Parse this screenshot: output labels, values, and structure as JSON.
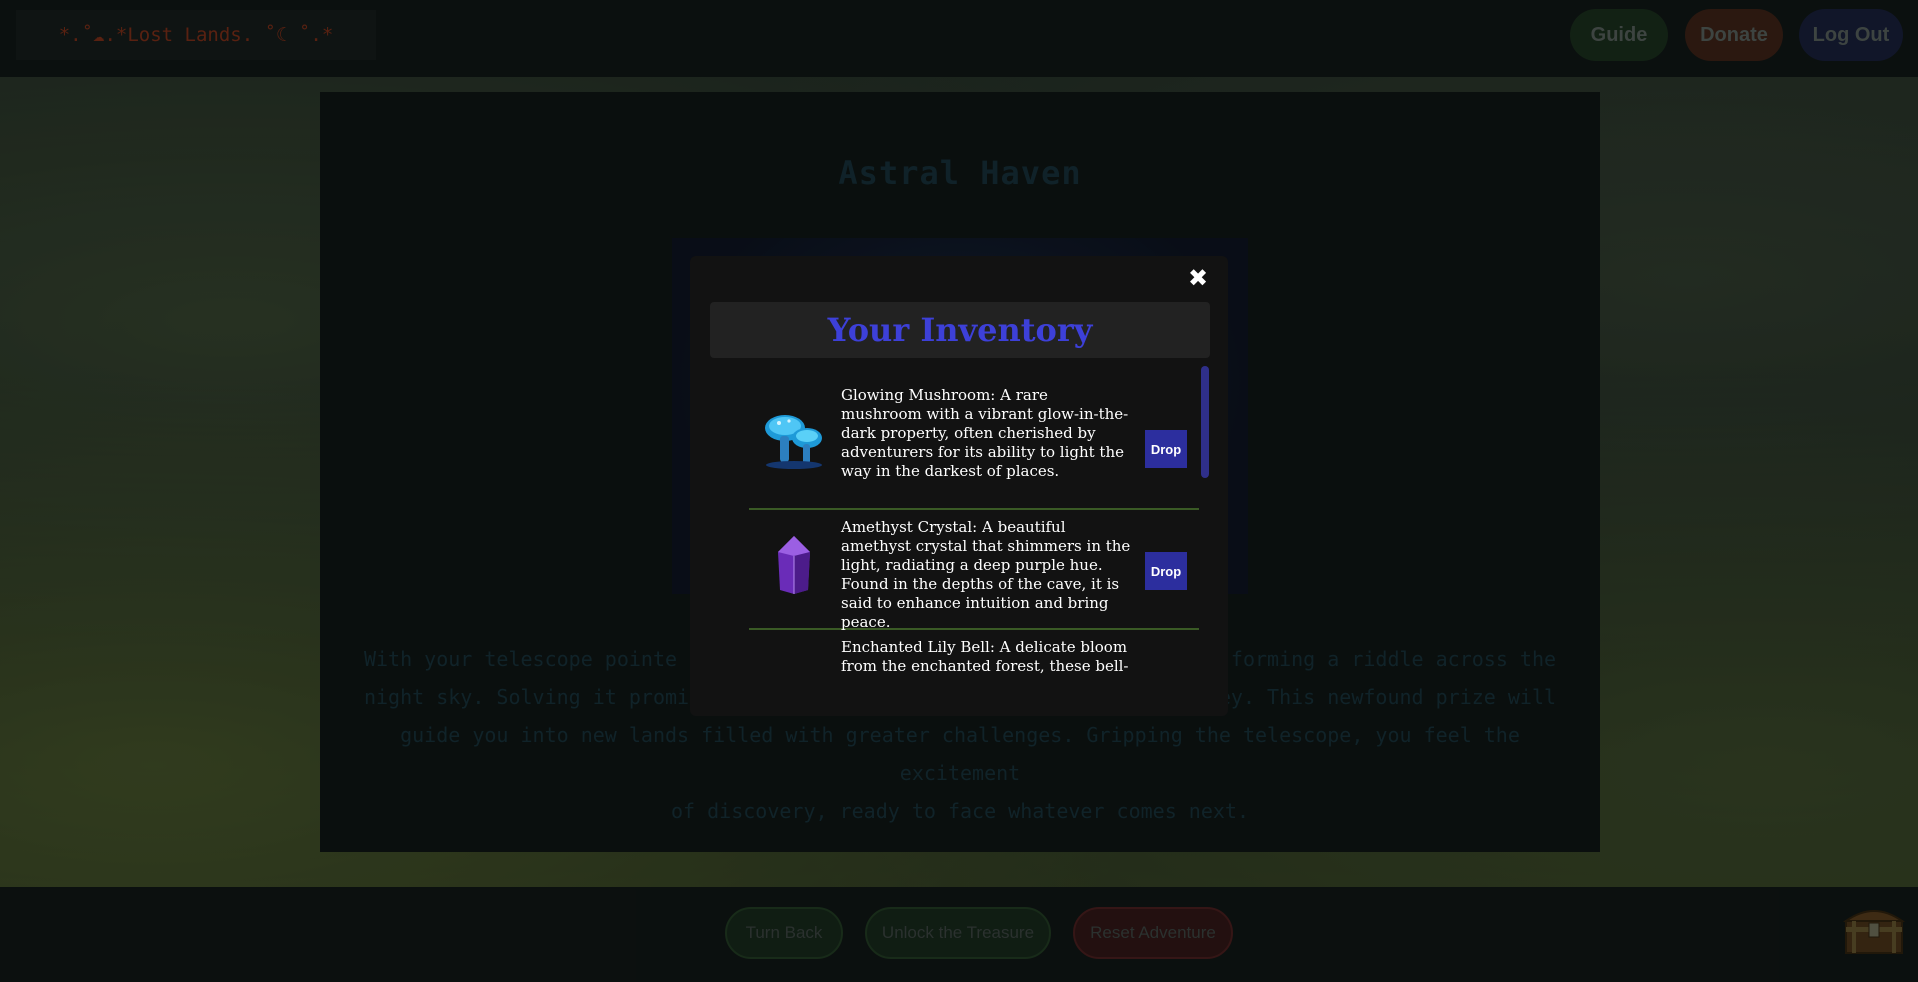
{
  "header": {
    "logo_text": "*.˚☁︎.*Lost Lands. ˚☾ ˚.*",
    "guide_label": "Guide",
    "donate_label": "Donate",
    "logout_label": "Log Out"
  },
  "scene": {
    "title": "Astral Haven",
    "story_lines": [
      "With your telescope pointe                                              forming a riddle across the",
      "night sky. Solving it promis                                           ey. This newfound prize will",
      "guide you into new lands filled with greater challenges. Gripping the telescope, you feel the excitement",
      "of discovery, ready to face whatever comes next."
    ]
  },
  "footer": {
    "turn_back_label": "Turn Back",
    "unlock_label": "Unlock the Treasure",
    "reset_label": "Reset Adventure"
  },
  "inventory": {
    "title": "Your Inventory",
    "close_symbol": "✖",
    "items": [
      {
        "icon": "glowing-mushroom-icon",
        "description": "Glowing Mushroom: A rare mushroom with a vibrant glow-in-the-dark property, often cherished by adventurers for its ability to light the way in the darkest of places.",
        "drop_label": "Drop"
      },
      {
        "icon": "amethyst-crystal-icon",
        "description": "Amethyst Crystal: A beautiful amethyst crystal that shimmers in the light, radiating a deep purple hue. Found in the depths of the cave, it is said to enhance intuition and bring peace.",
        "drop_label": "Drop"
      },
      {
        "icon": "",
        "description": "Enchanted Lily Bell: A delicate bloom from the enchanted forest, these bell-",
        "drop_label": ""
      }
    ]
  },
  "colors": {
    "modal_title": "#3d40d8",
    "drop_button": "#2c2e9e",
    "divider": "#3a5a25"
  }
}
